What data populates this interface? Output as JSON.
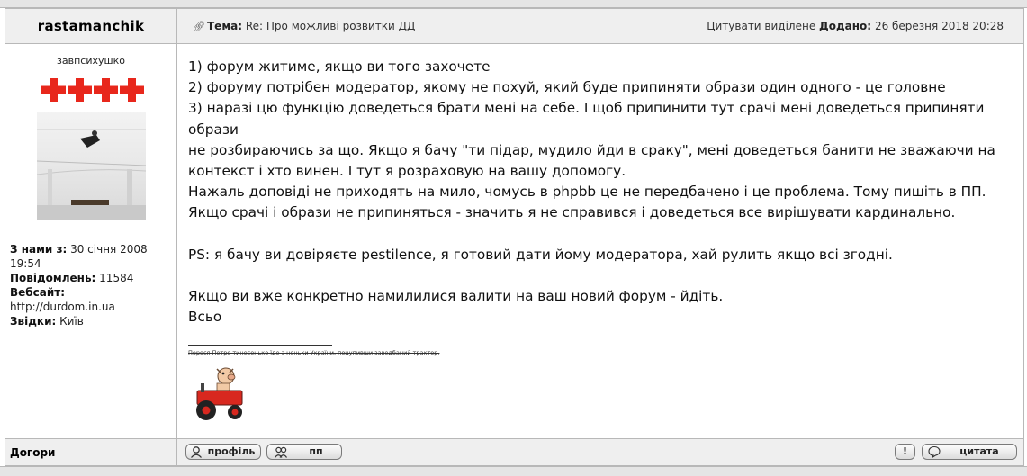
{
  "author": {
    "name": "rastamanchik",
    "rank": "завпсихушко",
    "info": [
      {
        "label": "З нами з:",
        "value": "30 січня 2008 19:54"
      },
      {
        "label": "Повідомлень:",
        "value": "11584"
      },
      {
        "label": "Вебсайт:",
        "value": "http://durdom.in.ua"
      },
      {
        "label": "Звідки:",
        "value": "Київ"
      }
    ]
  },
  "header": {
    "subject_label": "Тема:",
    "subject": "Re: Про можливі розвитки ДД",
    "quote_selected": "Цитувати виділене",
    "added_label": "Додано:",
    "added_date": "26 березня 2018 20:28"
  },
  "post": {
    "lines": [
      "1) форум житиме, якщо ви того захочете",
      "2) форуму потрібен модератор, якому не похуй, який буде припиняти образи один одного - це головне",
      "3) наразі цю функцію доведеться брати мені на себе. І щоб припинити тут срачі мені доведеться припиняти образи",
      "не розбираючись за що. Якщо я бачу \"ти підар, мудило йди в сраку\", мені доведеться банити не зважаючи на",
      "контекст і хто винен. І тут я розраховую на вашу допомогу.",
      "Нажаль доповіді не приходять на мило, чомусь в phpbb це не передбачено і це проблема. Тому пишіть в ПП.",
      "Якщо срачі і образи не припиняться - значить я не справився і доведеться все вирішувати кардинально.",
      "",
      "PS: я бачу ви довіряєте pestilence, я готовий дати йому модератора, хай рулить якщо всі згодні.",
      "",
      "Якщо ви вже конкретно намилилися валити на ваш новий форум - йдіть.",
      "Всьо"
    ],
    "signature": "Порося Петро тинесенько їде з неньки України, поцупивши заведбаний трактор."
  },
  "footer": {
    "label": "Догори",
    "profile_button": "профіль",
    "pm_button": "пп",
    "report_button": "!",
    "quote_button": "цитата"
  },
  "colors": {
    "header_bg": "#efefef",
    "border": "#b8b8b8",
    "crosses": "#e8271c"
  }
}
